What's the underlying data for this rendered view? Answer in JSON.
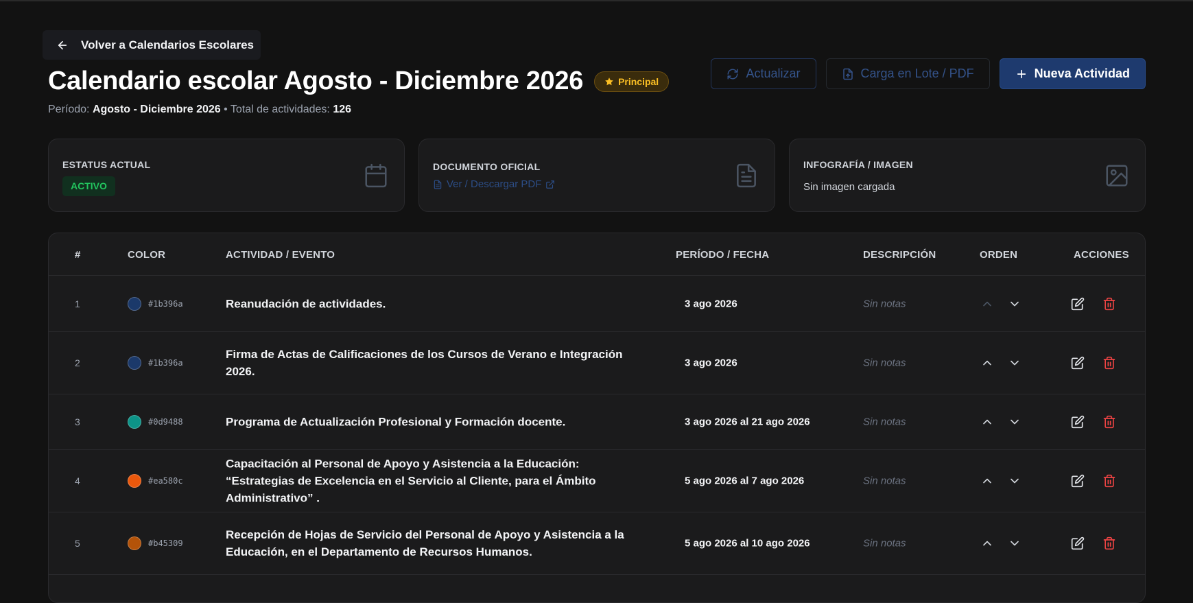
{
  "back": {
    "label": "Volver a Calendarios Escolares"
  },
  "header": {
    "title": "Calendario escolar Agosto - Diciembre 2026",
    "badge": "Principal",
    "period_label": "Período:",
    "period_value": "Agosto - Diciembre 2026",
    "separator": "•",
    "total_label": "Total de actividades:",
    "total_value": "126"
  },
  "toolbar": {
    "refresh_label": "Actualizar",
    "batch_label": "Carga en Lote / PDF",
    "new_label": "Nueva Actividad"
  },
  "cards": {
    "status": {
      "label": "Estatus actual",
      "value": "ACTIVO",
      "icon": "calendar-icon"
    },
    "document": {
      "label": "Documento oficial",
      "link": "Ver / Descargar PDF",
      "icon": "document-icon"
    },
    "image": {
      "label": "Infografía / Imagen",
      "value": "Sin imagen cargada",
      "icon": "image-icon"
    }
  },
  "table": {
    "headers": {
      "num": "#",
      "color": "Color",
      "activity": "Actividad / Evento",
      "period": "Período / Fecha",
      "description": "Descripción",
      "order": "Orden",
      "actions": "Acciones"
    },
    "rows": [
      {
        "num": "1",
        "color": "#1b396a",
        "hex": "#1b396a",
        "activity": "Reanudación de actividades.",
        "date": "3 ago 2026",
        "desc": "Sin notas",
        "up_disabled": true
      },
      {
        "num": "2",
        "color": "#1b396a",
        "hex": "#1b396a",
        "activity": "Firma de Actas de Calificaciones de los Cursos de Verano e Integración 2026.",
        "date": "3 ago 2026",
        "desc": "Sin notas",
        "up_disabled": false
      },
      {
        "num": "3",
        "color": "#0d9488",
        "hex": "#0d9488",
        "activity": "Programa de Actualización Profesional y Formación docente.",
        "date": "3 ago 2026 al 21 ago 2026",
        "desc": "Sin notas",
        "up_disabled": false
      },
      {
        "num": "4",
        "color": "#ea580c",
        "hex": "#ea580c",
        "activity": "Capacitación al Personal de Apoyo y Asistencia a la Educación: “Estrategias de Excelencia en el Servicio al Cliente, para el Ámbito Administrativo” .",
        "date": "5 ago 2026 al 7 ago 2026",
        "desc": "Sin notas",
        "up_disabled": false
      },
      {
        "num": "5",
        "color": "#b45309",
        "hex": "#b45309",
        "activity": "Recepción de Hojas de Servicio del Personal de Apoyo y Asistencia a la Educación, en el Departamento de Recursos Humanos.",
        "date": "5 ago 2026 al 10 ago 2026",
        "desc": "Sin notas",
        "up_disabled": false
      }
    ]
  }
}
